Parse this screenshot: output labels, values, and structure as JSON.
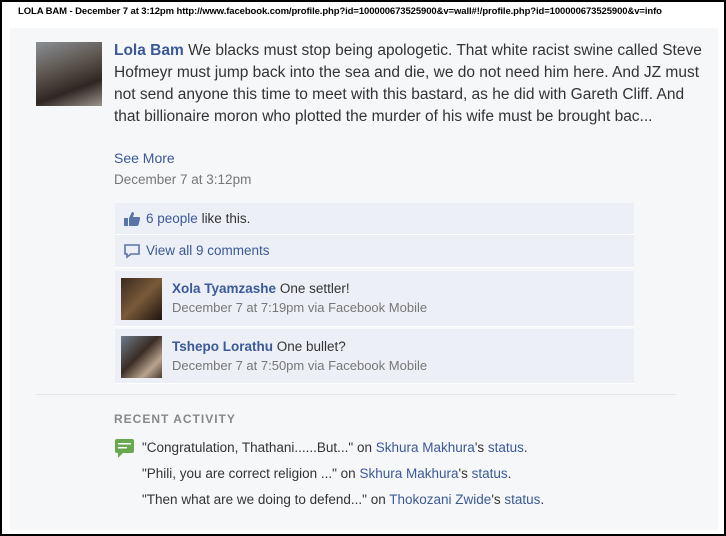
{
  "caption": "LOLA BAM -  December 7 at 3:12pm http://www.facebook.com/profile.php?id=100000673525900&v=wall#!/profile.php?id=100000673525900&v=info",
  "post": {
    "author": "Lola Bam",
    "text": "We blacks must stop being apologetic. That white racist swine called Steve Hofmeyr must jump back into the sea and die, we do not need him here. And JZ must not send anyone this time to meet with this bastard, as he did with Gareth Cliff. And that billionaire moron who plotted the murder of his wife must be brought bac...",
    "see_more": "See More",
    "time": "December 7 at 3:12pm"
  },
  "likes": {
    "count_text": "6 people",
    "suffix": " like this."
  },
  "comments_link": "View all 9 comments",
  "comments": [
    {
      "name": "Xola Tyamzashe",
      "text": "One settler!",
      "meta": "December 7 at 7:19pm via Facebook Mobile"
    },
    {
      "name": "Tshepo Lorathu",
      "text": "One bullet?",
      "meta": "December 7 at 7:50pm via Facebook Mobile"
    }
  ],
  "recent_activity": {
    "heading": "RECENT ACTIVITY",
    "items": [
      {
        "quote": "\"Congratulation, Thathani......But...\"",
        "on": " on ",
        "person": "Skhura Makhura",
        "possessive": "'s ",
        "target": "status",
        "end": "."
      },
      {
        "quote": "\"Phili, you are correct religion ...\"",
        "on": " on ",
        "person": "Skhura Makhura",
        "possessive": "'s ",
        "target": "status",
        "end": "."
      },
      {
        "quote": "\"Then what are we doing to defend...\"",
        "on": " on ",
        "person": "Thokozani Zwide",
        "possessive": "'s ",
        "target": "status",
        "end": "."
      }
    ]
  },
  "colors": {
    "link": "#3b5998",
    "box_bg": "#eceff5",
    "meta": "#777777"
  },
  "icons": [
    "thumbs-up-icon",
    "comment-bubble-icon",
    "message-icon"
  ]
}
